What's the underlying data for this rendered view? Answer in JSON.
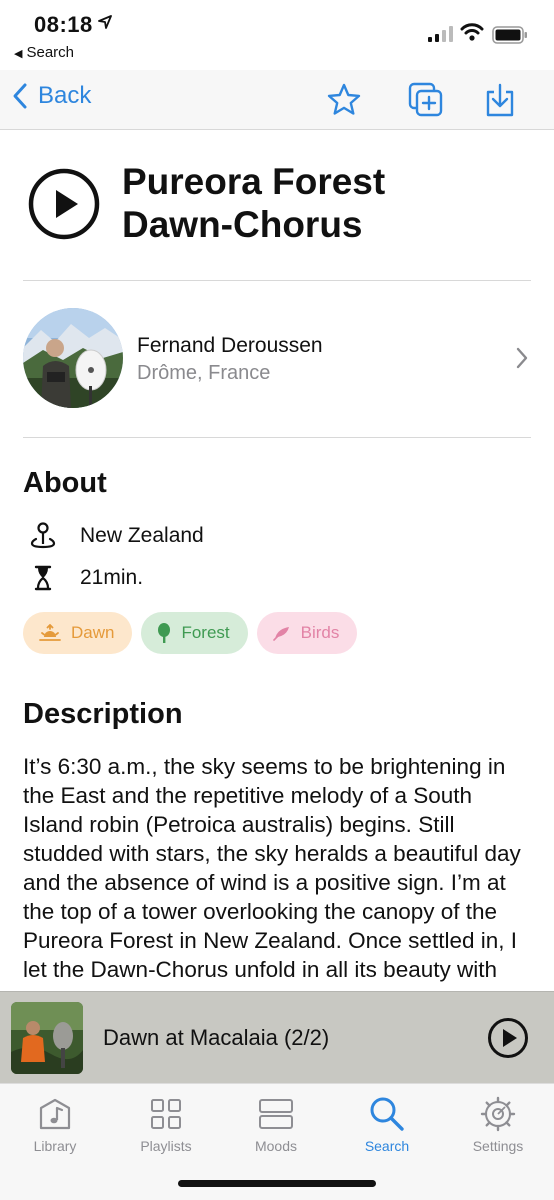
{
  "status_bar": {
    "time": "08:18",
    "back_app": "Search"
  },
  "nav": {
    "back_label": "Back",
    "icons": [
      "star-icon",
      "add-to-playlist-icon",
      "download-icon"
    ],
    "accent_color": "#2e86de"
  },
  "recording": {
    "title_line1": "Pureora Forest",
    "title_line2": "Dawn-Chorus"
  },
  "artist": {
    "name": "Fernand Deroussen",
    "location": "Drôme, France"
  },
  "about": {
    "heading": "About",
    "location": "New Zealand",
    "duration": "21min.",
    "tags": [
      {
        "label": "Dawn",
        "icon": "sunrise-icon",
        "color": "#e59a3a"
      },
      {
        "label": "Forest",
        "icon": "tree-icon",
        "color": "#3f9a52"
      },
      {
        "label": "Birds",
        "icon": "feather-icon",
        "color": "#e283a6"
      }
    ]
  },
  "description": {
    "heading": "Description",
    "text": "It’s 6:30 a.m., the sky seems to be brightening in the East and the repetitive melody of a South Island robin (Petroica australis) begins. Still studded with stars, the sky heralds a beautiful day and the absence of wind is a positive sign. I’m at the top of a tower overlooking the canopy of the Pureora Forest in New Zealand. Once settled in, I let the Dawn-Chorus unfold in all its beauty with"
  },
  "now_playing": {
    "title": "Dawn at Macalaia (2/2)"
  },
  "tabs": [
    {
      "label": "Library",
      "icon": "library-icon",
      "active": false
    },
    {
      "label": "Playlists",
      "icon": "playlists-grid-icon",
      "active": false
    },
    {
      "label": "Moods",
      "icon": "moods-icon",
      "active": false
    },
    {
      "label": "Search",
      "icon": "search-icon",
      "active": true
    },
    {
      "label": "Settings",
      "icon": "gear-icon",
      "active": false
    }
  ]
}
